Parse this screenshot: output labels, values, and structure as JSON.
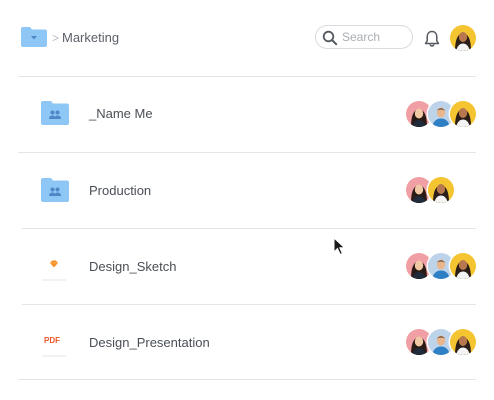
{
  "breadcrumb": {
    "separator": ">",
    "current": "Marketing"
  },
  "search": {
    "placeholder": "Search"
  },
  "files": [
    {
      "name": "_Name Me",
      "type": "shared-folder"
    },
    {
      "name": "Production",
      "type": "shared-folder"
    },
    {
      "name": "Design_Sketch",
      "type": "sketch-file"
    },
    {
      "name": "Design_Presentation",
      "type": "pdf-file",
      "badge": "PDF"
    }
  ],
  "colors": {
    "folder_blue": "#8ec7f6",
    "folder_blue_dark": "#6ab1ec",
    "divider": "#e3e5e8",
    "pdf_red": "#e8562a",
    "sketch_orange": "#f5922a"
  },
  "icons": {
    "breadcrumb_folder": "folder-icon",
    "search": "search-icon",
    "notifications": "bell-icon",
    "shared_folder": "shared-folder-icon",
    "sketch_file": "sketch-file-icon",
    "pdf_file": "pdf-file-icon"
  }
}
